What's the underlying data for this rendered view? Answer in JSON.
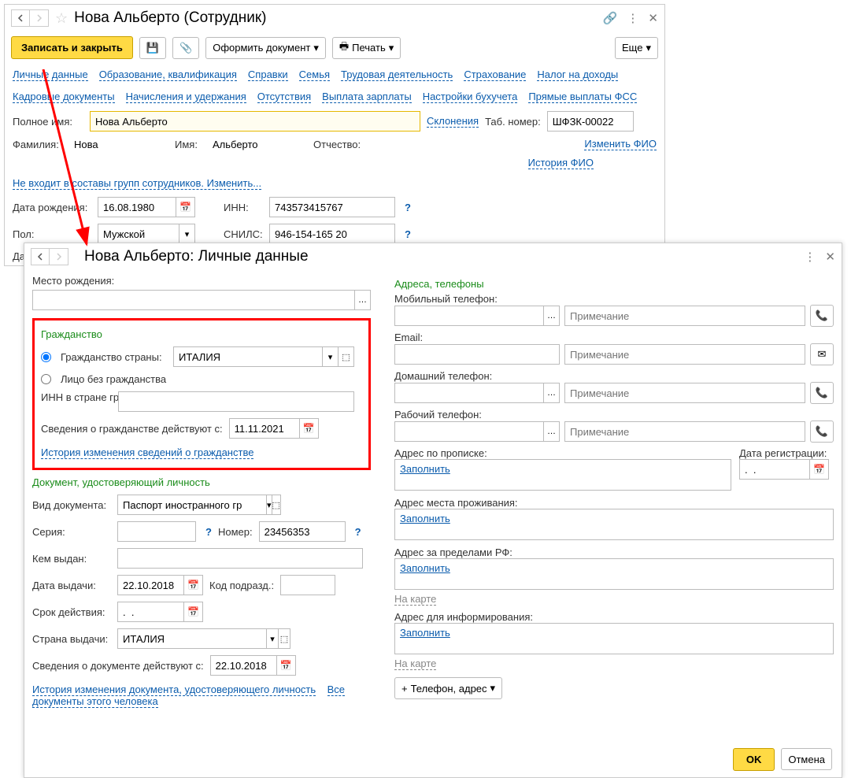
{
  "win1": {
    "title": "Нова Альберто (Сотрудник)",
    "toolbar": {
      "save_close": "Записать и закрыть",
      "doc": "Оформить документ",
      "print": "Печать",
      "more": "Еще"
    },
    "tabs1": [
      "Личные данные",
      "Образование, квалификация",
      "Справки",
      "Семья",
      "Трудовая деятельность",
      "Страхование",
      "Налог на доходы"
    ],
    "tabs2": [
      "Кадровые документы",
      "Начисления и удержания",
      "Отсутствия",
      "Выплата зарплаты",
      "Настройки бухучета",
      "Прямые выплаты ФСС"
    ],
    "fullname_label": "Полное имя:",
    "fullname": "Нова Альберто",
    "declension": "Склонения",
    "tabnum_label": "Таб. номер:",
    "tabnum": "ШФЗК-00022",
    "lastname_label": "Фамилия:",
    "lastname": "Нова",
    "firstname_label": "Имя:",
    "firstname": "Альберто",
    "patronymic_label": "Отчество:",
    "change_fio": "Изменить ФИО",
    "history_fio": "История ФИО",
    "groups": "Не входит в составы групп сотрудников. Изменить...",
    "dob_label": "Дата рождения:",
    "dob": "16.08.1980",
    "inn_label": "ИНН:",
    "inn": "743573415767",
    "sex_label": "Пол:",
    "sex": "Мужской",
    "snils_label": "СНИЛС:",
    "snils": "946-154-165 20",
    "dat_label": "Дат"
  },
  "win2": {
    "title": "Нова Альберто: Личные данные",
    "birthplace_label": "Место рождения:",
    "citizenship_section": "Гражданство",
    "citizen_country_label": "Гражданство страны:",
    "citizen_country": "ИТАЛИЯ",
    "no_citizen": "Лицо без гражданства",
    "inn_foreign_label": "ИНН в стране гражданства:",
    "citizen_valid_label": "Сведения о гражданстве действуют с:",
    "citizen_valid": "11.11.2021",
    "citizen_history": "История изменения сведений о гражданстве",
    "iddoc_section": "Документ, удостоверяющий личность",
    "doctype_label": "Вид документа:",
    "doctype": "Паспорт иностранного гр",
    "series_label": "Серия:",
    "number_label": "Номер:",
    "number": "23456353",
    "issued_by_label": "Кем выдан:",
    "issue_date_label": "Дата выдачи:",
    "issue_date": "22.10.2018",
    "dept_code_label": "Код подразд.:",
    "validity_label": "Срок действия:",
    "validity": ".  .",
    "issue_country_label": "Страна выдачи:",
    "issue_country": "ИТАЛИЯ",
    "doc_valid_label": "Сведения о документе действуют с:",
    "doc_valid": "22.10.2018",
    "doc_history": "История изменения документа, удостоверяющего личность",
    "all_docs": "Все документы этого человека",
    "addr_section": "Адреса, телефоны",
    "mobile_label": "Мобильный телефон:",
    "email_label": "Email:",
    "home_label": "Домашний телефон:",
    "work_label": "Рабочий телефон:",
    "note_ph": "Примечание",
    "addr_reg_label": "Адрес по прописке:",
    "reg_date_label": "Дата регистрации:",
    "reg_date": ".  .",
    "fill": "Заполнить",
    "addr_live_label": "Адрес места проживания:",
    "addr_abroad_label": "Адрес за пределами РФ:",
    "on_map": "На карте",
    "addr_inform_label": "Адрес для информирования:",
    "add_phone": "Телефон, адрес",
    "ok": "OK",
    "cancel": "Отмена"
  }
}
